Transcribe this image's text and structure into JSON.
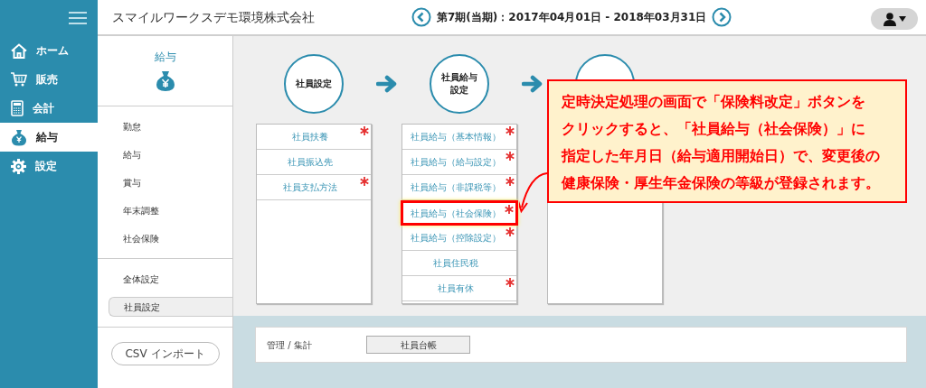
{
  "header": {
    "company": "スマイルワークスデモ環境株式会社",
    "period": "第7期(当期)：2017年04月01日 - 2018年03月31日"
  },
  "nav": [
    {
      "label": "ホーム",
      "selected": false
    },
    {
      "label": "販売",
      "selected": false
    },
    {
      "label": "会計",
      "selected": false
    },
    {
      "label": "給与",
      "selected": true
    },
    {
      "label": "設定",
      "selected": false
    }
  ],
  "module": {
    "title": "給与"
  },
  "menu_groups": [
    [
      {
        "label": "勤怠",
        "selected": false
      },
      {
        "label": "給与",
        "selected": false
      },
      {
        "label": "賞与",
        "selected": false
      },
      {
        "label": "年末調整",
        "selected": false
      },
      {
        "label": "社会保険",
        "selected": false
      }
    ],
    [
      {
        "label": "全体設定",
        "selected": false
      },
      {
        "label": "社員設定",
        "selected": true
      }
    ]
  ],
  "csv_button": "CSV インポート",
  "flow": [
    {
      "kind": "step",
      "title": "社員設定",
      "items": [
        {
          "label": "社員扶養",
          "required": true,
          "highlighted": false
        },
        {
          "label": "社員振込先",
          "required": false,
          "highlighted": false
        },
        {
          "label": "社員支払方法",
          "required": true,
          "highlighted": false
        }
      ]
    },
    {
      "kind": "step",
      "title": "社員給与設定",
      "items": [
        {
          "label": "社員給与（基本情報）",
          "required": true,
          "highlighted": false
        },
        {
          "label": "社員給与（給与設定）",
          "required": true,
          "highlighted": false
        },
        {
          "label": "社員給与（非課税等）",
          "required": true,
          "highlighted": false
        },
        {
          "label": "社員給与（社会保険）",
          "required": true,
          "highlighted": true
        },
        {
          "label": "社員給与（控除設定）",
          "required": true,
          "highlighted": false
        },
        {
          "label": "社員住民税",
          "required": false,
          "highlighted": false
        },
        {
          "label": "社員有休",
          "required": true,
          "highlighted": false
        }
      ]
    },
    {
      "kind": "step"
    }
  ],
  "bottom": {
    "label": "管理 / 集計",
    "button": "社員台帳"
  },
  "callout": {
    "lines": [
      "定時決定処理の画面で「保険料改定」ボタンを",
      "クリックすると、「社員給与（社会保険）」に",
      "指定した年月日（給与適用開始日）で、変更後の",
      "健康保険・厚生年金保険の等級が登録されます。"
    ]
  }
}
